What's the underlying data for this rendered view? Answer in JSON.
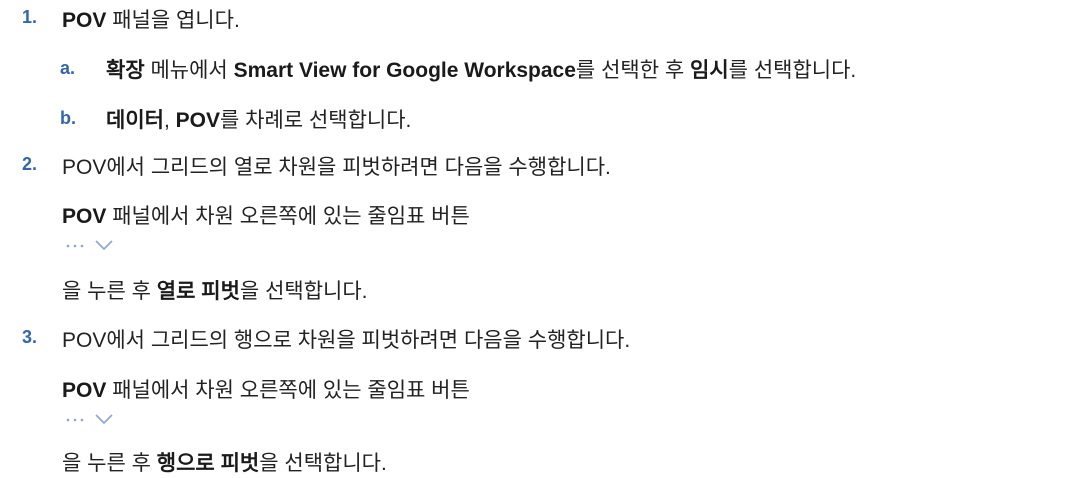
{
  "steps": [
    {
      "num": "1.",
      "bold": "POV",
      "text": " 패널을 엽니다.",
      "substeps": [
        {
          "num": "a.",
          "parts": [
            {
              "b": "확장"
            },
            {
              "t": " 메뉴에서 "
            },
            {
              "b": "Smart View for Google Workspace"
            },
            {
              "t": "를 선택한 후 "
            },
            {
              "b": "임시"
            },
            {
              "t": "를 선택합니다."
            }
          ]
        },
        {
          "num": "b.",
          "parts": [
            {
              "b": "데이터"
            },
            {
              "t": ", "
            },
            {
              "b": "POV"
            },
            {
              "t": "를 차례로 선택합니다."
            }
          ]
        }
      ]
    },
    {
      "num": "2.",
      "text": "POV에서 그리드의 열로 차원을 피벗하려면 다음을 수행합니다.",
      "line2_bold": "POV",
      "line2_text": " 패널에서 차원 오른쪽에 있는 줄임표 버튼",
      "line3_pre": "을 누른 후 ",
      "line3_bold": "열로 피벗",
      "line3_post": "을 선택합니다."
    },
    {
      "num": "3.",
      "text": "POV에서 그리드의 행으로 차원을 피벗하려면 다음을 수행합니다.",
      "line2_bold": "POV",
      "line2_text": " 패널에서 차원 오른쪽에 있는 줄임표 버튼",
      "line3_pre": "을 누른 후 ",
      "line3_bold": "행으로 피벗",
      "line3_post": "을 선택합니다."
    }
  ],
  "icon_color": "#8aa6d6"
}
